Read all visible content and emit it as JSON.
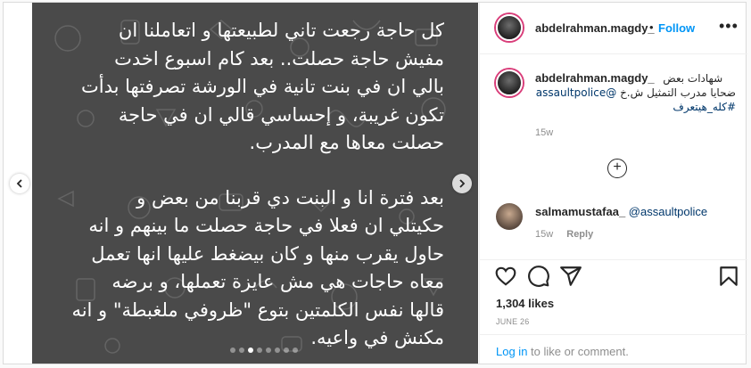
{
  "media": {
    "paragraph1": [
      "كل حاجة رجعت تاني لطبيعتها و اتعاملنا ان",
      "مفيش حاجة حصلت.. بعد كام اسبوع اخدت",
      "بالي ان في بنت تانية في الورشة تصرفتها بدأت",
      "تكون غريبة، و إحساسي قالي ان في حاجة",
      "حصلت معاها مع المدرب."
    ],
    "paragraph2": [
      "بعد فترة انا و البنت دي قربنا من بعض و",
      "حكيتلي ان فعلا في حاجة حصلت ما بينهم و انه",
      "حاول يقرب منها و كان بيضغط عليها انها تعمل",
      "معاه حاجات هي مش عايزة تعملها، و برضه",
      "قالها نفس الكلمتين بتوع \"ظروفي ملغبطة\" و انه",
      "مكنش في واعيه."
    ],
    "prev_icon": "chevron-left-icon",
    "next_icon": "chevron-right-icon",
    "carousel_dots": 8,
    "active_dot": 2
  },
  "header": {
    "username": "abdelrahman.magdy_",
    "separator": "•",
    "follow_label": "Follow",
    "more_icon": "more-icon",
    "more_text": "•••"
  },
  "caption": {
    "username": "abdelrahman.magdy_",
    "text_line1": "شهادات بعض",
    "text_line2": "ضحايا مدرب التمثيل ش.خ",
    "mention": "@assaultpolice",
    "hashtag": "#كله_هيتعرف",
    "time": "15w"
  },
  "load_more_icon": "plus-circle-icon",
  "load_more_text": "+",
  "comment": {
    "username": "salmamustafaa_",
    "mention": "@assaultpolice",
    "time": "15w",
    "reply_label": "Reply"
  },
  "actions": {
    "like_icon": "heart-icon",
    "comment_icon": "comment-icon",
    "share_icon": "share-icon",
    "save_icon": "bookmark-icon"
  },
  "likes": "1,304 likes",
  "date": "JUNE 26",
  "login": {
    "link": "Log in",
    "text": " to like or comment."
  },
  "colors": {
    "accent": "#0095f6",
    "media_bg": "#4a4a4a",
    "story_ring": "#d93e7a"
  }
}
